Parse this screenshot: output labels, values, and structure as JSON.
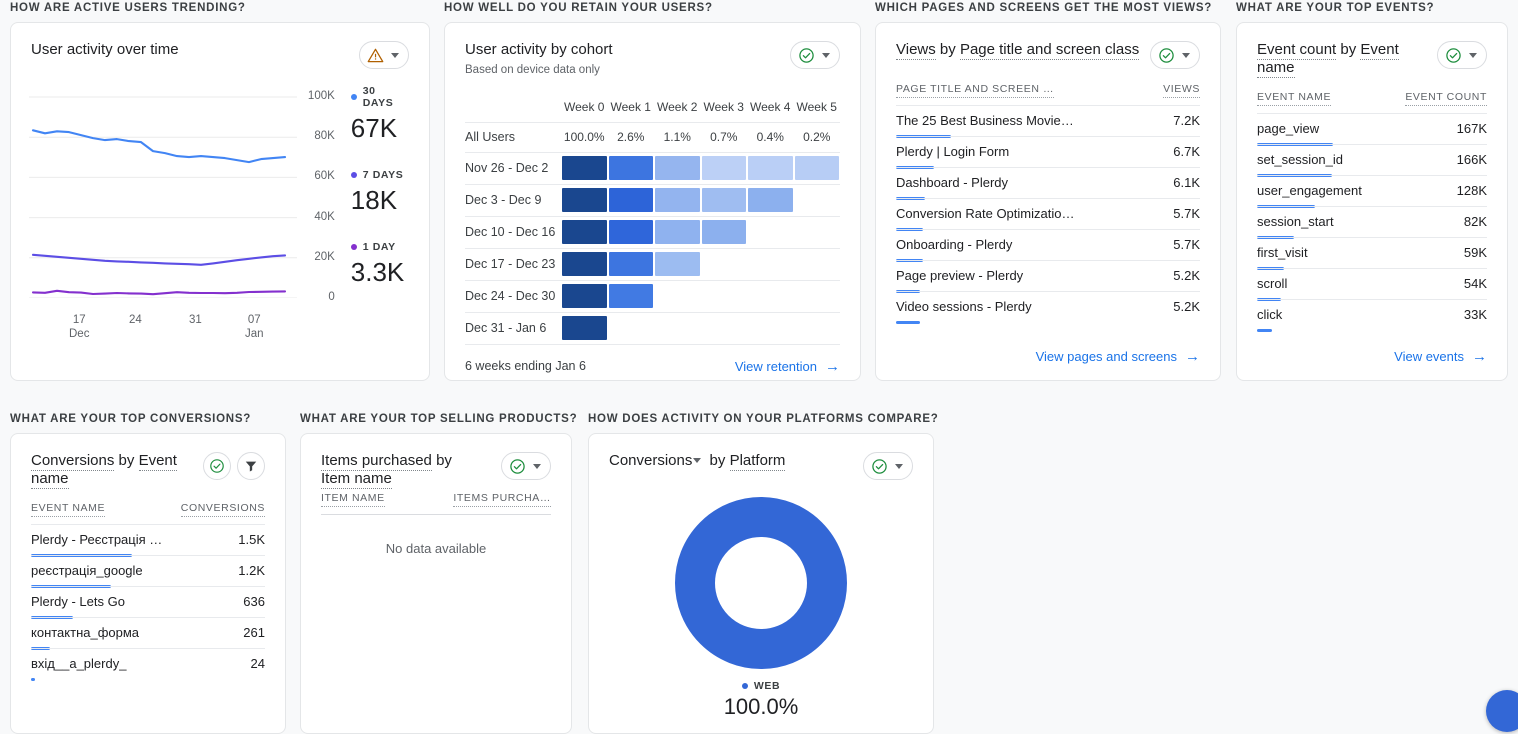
{
  "sections": {
    "active_users": "HOW ARE ACTIVE USERS TRENDING?",
    "retention": "HOW WELL DO YOU RETAIN YOUR USERS?",
    "pages": "WHICH PAGES AND SCREENS GET THE MOST VIEWS?",
    "events": "WHAT ARE YOUR TOP EVENTS?",
    "conversions": "WHAT ARE YOUR TOP CONVERSIONS?",
    "products": "WHAT ARE YOUR TOP SELLING PRODUCTS?",
    "platforms": "HOW DOES ACTIVITY ON YOUR PLATFORMS COMPARE?"
  },
  "colors": {
    "accent_blue": "#1a73e8",
    "bar_blue": "#4285f4",
    "series_30d": "#4285f4",
    "series_7d": "#5c4ee5",
    "series_1d": "#8430ce",
    "donut_web": "#3367d6",
    "cohort_w0": "#1a478f",
    "warning": "#b06000",
    "ok_green": "#1e8e3e"
  },
  "cards": {
    "user_activity": {
      "title": "User activity over time",
      "badge_icon": "warning-triangle-icon",
      "caret_icon": "chevron-down-icon"
    },
    "cohort": {
      "title": "User activity by cohort",
      "subtitle": "Based on device data only",
      "badge_icon": "check-circle-icon",
      "caret_icon": "chevron-down-icon",
      "columns": [
        "Week 0",
        "Week 1",
        "Week 2",
        "Week 3",
        "Week 4",
        "Week 5"
      ],
      "all_users_label": "All Users",
      "all_users_values": [
        "100.0%",
        "2.6%",
        "1.1%",
        "0.7%",
        "0.4%",
        "0.2%"
      ],
      "rows": [
        {
          "label": "Nov 26 - Dec 2",
          "cells": [
            "#1a478f",
            "#3d75e0",
            "#95b5ef",
            "#bcd0f6",
            "#bacff6",
            "#b7cdf5"
          ]
        },
        {
          "label": "Dec 3 - Dec 9",
          "cells": [
            "#1a478f",
            "#2d64d8",
            "#93b4ef",
            "#9fbdf1",
            "#8cb0ee",
            null
          ]
        },
        {
          "label": "Dec 10 - Dec 16",
          "cells": [
            "#1a478f",
            "#2f66da",
            "#8fb2ef",
            "#8cb0ee",
            null,
            null
          ]
        },
        {
          "label": "Dec 17 - Dec 23",
          "cells": [
            "#1a478f",
            "#3d75e0",
            "#9cbcf1",
            null,
            null,
            null
          ]
        },
        {
          "label": "Dec 24 - Dec 30",
          "cells": [
            "#1a478f",
            "#417ae3",
            null,
            null,
            null,
            null
          ]
        },
        {
          "label": "Dec 31 - Jan 6",
          "cells": [
            "#1a478f",
            null,
            null,
            null,
            null,
            null
          ]
        }
      ],
      "footer_note": "6 weeks ending Jan 6",
      "view_link": "View retention"
    },
    "pages": {
      "title_metric": "Views",
      "title_by": "by",
      "title_dimension": "Page title and screen class",
      "badge_icon": "check-circle-icon",
      "caret_icon": "chevron-down-icon",
      "col_name": "PAGE TITLE AND SCREEN …",
      "col_value": "VIEWS",
      "rows": [
        {
          "name": "The 25 Best Business Movie…",
          "value": "7.2K",
          "pct": 100
        },
        {
          "name": "Plerdy | Login Form",
          "value": "6.7K",
          "pct": 93
        },
        {
          "name": "Dashboard - Plerdy",
          "value": "6.1K",
          "pct": 85
        },
        {
          "name": "Conversion Rate Optimizatio…",
          "value": "5.7K",
          "pct": 79
        },
        {
          "name": "Onboarding - Plerdy",
          "value": "5.7K",
          "pct": 79
        },
        {
          "name": "Page preview - Plerdy",
          "value": "5.2K",
          "pct": 72
        },
        {
          "name": "Video sessions - Plerdy",
          "value": "5.2K",
          "pct": 72
        }
      ],
      "view_link": "View pages and screens"
    },
    "events": {
      "title_metric": "Event count",
      "title_by": "by",
      "title_dimension": "Event name",
      "badge_icon": "check-circle-icon",
      "caret_icon": "chevron-down-icon",
      "col_name": "EVENT NAME",
      "col_value": "EVENT COUNT",
      "rows": [
        {
          "name": "page_view",
          "value": "167K",
          "pct": 100
        },
        {
          "name": "set_session_id",
          "value": "166K",
          "pct": 99
        },
        {
          "name": "user_engagement",
          "value": "128K",
          "pct": 77
        },
        {
          "name": "session_start",
          "value": "82K",
          "pct": 49
        },
        {
          "name": "first_visit",
          "value": "59K",
          "pct": 35
        },
        {
          "name": "scroll",
          "value": "54K",
          "pct": 32
        },
        {
          "name": "click",
          "value": "33K",
          "pct": 20
        }
      ],
      "view_link": "View events"
    },
    "conversions": {
      "title_metric": "Conversions",
      "title_by": "by",
      "title_dimension": "Event name",
      "badge_icon": "check-circle-icon",
      "filter_icon": "filter-funnel-icon",
      "col_name": "EVENT NAME",
      "col_value": "CONVERSIONS",
      "rows": [
        {
          "name": "Plerdy - Реєстрація …",
          "value": "1.5K",
          "pct": 100
        },
        {
          "name": "реєстрація_google",
          "value": "1.2K",
          "pct": 80
        },
        {
          "name": "Plerdy - Lets Go",
          "value": "636",
          "pct": 42
        },
        {
          "name": "контактна_форма",
          "value": "261",
          "pct": 17
        },
        {
          "name": "вхід__a_plerdy_",
          "value": "24",
          "pct": 2
        }
      ]
    },
    "products": {
      "title_metric": "Items purchased",
      "title_by": "by",
      "title_dimension": "Item name",
      "badge_icon": "check-circle-icon",
      "caret_icon": "chevron-down-icon",
      "col_name": "ITEM NAME",
      "col_value": "ITEMS PURCHA…",
      "empty_message": "No data available"
    },
    "platforms": {
      "title_metric": "Conversions",
      "title_by": "by",
      "title_dimension": "Platform",
      "metric_caret_icon": "chevron-down-icon",
      "badge_icon": "check-circle-icon",
      "caret_icon": "chevron-down-icon",
      "legend_label": "WEB",
      "legend_value": "100.0%"
    }
  },
  "chart_data": [
    {
      "type": "line",
      "title": "User activity over time",
      "xlabel": "",
      "ylabel": "",
      "ylim": [
        0,
        100000
      ],
      "yticks": [
        "0",
        "20K",
        "40K",
        "60K",
        "80K",
        "100K"
      ],
      "xticks": [
        "17\nDec",
        "24",
        "31",
        "07\nJan"
      ],
      "grid": true,
      "legend_position": "right",
      "summary": [
        {
          "name": "30 DAYS",
          "value": "67K",
          "color": "#4285f4"
        },
        {
          "name": "7 DAYS",
          "value": "18K",
          "color": "#5c4ee5"
        },
        {
          "name": "1 DAY",
          "value": "3.3K",
          "color": "#8430ce"
        }
      ],
      "series": [
        {
          "name": "30 DAYS",
          "color": "#4285f4",
          "values": [
            83000,
            81500,
            82500,
            82000,
            80500,
            79000,
            78000,
            78500,
            77500,
            77000,
            72500,
            71500,
            70000,
            69500,
            70000,
            69500,
            69000,
            68000,
            67000,
            68500,
            69000,
            69500
          ]
        },
        {
          "name": "7 DAYS",
          "color": "#5c4ee5",
          "values": [
            21500,
            21000,
            20500,
            20000,
            19500,
            19000,
            18500,
            18200,
            18000,
            17700,
            17500,
            17200,
            17000,
            16800,
            16500,
            17200,
            18000,
            18800,
            19500,
            20200,
            20800,
            21200
          ]
        },
        {
          "name": "1 DAY",
          "color": "#8430ce",
          "values": [
            2800,
            2600,
            3600,
            2900,
            2700,
            2000,
            2200,
            2500,
            2300,
            2200,
            1900,
            2400,
            2900,
            2600,
            2500,
            2500,
            2400,
            2600,
            3000,
            3100,
            3200,
            3300
          ]
        }
      ]
    },
    {
      "type": "pie",
      "title": "Conversions by Platform",
      "labels": [
        "WEB"
      ],
      "values": [
        100.0
      ],
      "colors": [
        "#3367d6"
      ],
      "donut": true
    },
    {
      "type": "heatmap",
      "title": "User activity by cohort",
      "x": [
        "Week 0",
        "Week 1",
        "Week 2",
        "Week 3",
        "Week 4",
        "Week 5"
      ],
      "y": [
        "All Users",
        "Nov 26 - Dec 2",
        "Dec 3 - Dec 9",
        "Dec 10 - Dec 16",
        "Dec 17 - Dec 23",
        "Dec 24 - Dec 30",
        "Dec 31 - Jan 6"
      ],
      "all_users_percent": [
        100.0,
        2.6,
        1.1,
        0.7,
        0.4,
        0.2
      ]
    }
  ]
}
